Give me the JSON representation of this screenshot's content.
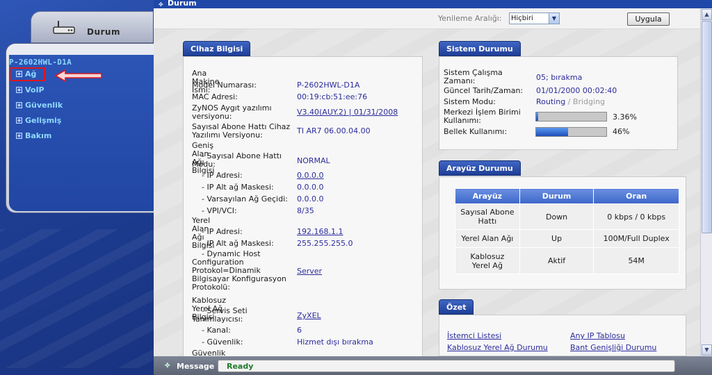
{
  "window": {
    "title": "Durum"
  },
  "sidebar": {
    "tab_label": "Durum",
    "model": "P-2602HWL-D1A",
    "items": [
      {
        "label": "Ağ"
      },
      {
        "label": "VoIP"
      },
      {
        "label": "Güvenlik"
      },
      {
        "label": "Gelişmiş"
      },
      {
        "label": "Bakım"
      }
    ]
  },
  "toolbar": {
    "refresh_label": "Yenileme Aralığı:",
    "refresh_value": "Hiçbiri",
    "apply_label": "Uygula"
  },
  "device": {
    "title": "Cihaz Bilgisi",
    "host_name_label": "Ana Makine İsmi:",
    "model_label": "Model Numarası:",
    "model_value": "P-2602HWL-D1A",
    "mac_label": "MAC Adresi:",
    "mac_value": "00:19:cb:51:ee:76",
    "zynos_label_1": "ZyNOS Aygıt yazılımı",
    "zynos_label_2": "versiyonu:",
    "zynos_value": "V3.40(AUY.2) | 01/31/2008",
    "dsl_fw_label_1": "Sayısal Abone Hattı Cihaz",
    "dsl_fw_label_2": "Yazılımı Versiyonu:",
    "dsl_fw_value": "TI AR7 06.00.04.00",
    "wan_heading": "Geniş Alan Ağı Bilgisi",
    "wan_mode_label_1": "- Sayısal Abone Hattı",
    "wan_mode_label_2": "Modu:",
    "wan_mode_value": "NORMAL",
    "wan_ip_label": "- IP Adresi:",
    "wan_ip_value": "0.0.0.0",
    "wan_mask_label": "- IP Alt ağ Maskesi:",
    "wan_mask_value": "0.0.0.0",
    "wan_gw_label": "- Varsayılan Ağ Geçidi:",
    "wan_gw_value": "0.0.0.0",
    "wan_vpi_label": "- VPI/VCI:",
    "wan_vpi_value": "8/35",
    "lan_heading": "Yerel Alan Ağı Bilgisi",
    "lan_ip_label": "- IP Adresi:",
    "lan_ip_value": "192.168.1.1",
    "lan_mask_label": "- IP Alt ağ Maskesi:",
    "lan_mask_value": "255.255.255.0",
    "dhcp_label_1": "- Dynamic Host",
    "dhcp_label_2": "Configuration",
    "dhcp_label_3": "Protokol=Dinamik",
    "dhcp_label_4": "Bilgisayar Konfigurasyon",
    "dhcp_label_5": "Protokolü:",
    "dhcp_value": "Server",
    "wlan_heading": "Kablosuz Yerel Ağ Bilgisi",
    "ssid_label_1": "- Servis Seti",
    "ssid_label_2": "Tanımlayıcısı:",
    "ssid_value": "ZyXEL",
    "channel_label": "- Kanal:",
    "channel_value": "6",
    "security_label": "- Güvenlik:",
    "security_value": "Hizmet dışı bırakma",
    "security_heading": "Güvenlik"
  },
  "system": {
    "title": "Sistem Durumu",
    "uptime_label_1": "Sistem Çalışma",
    "uptime_label_2": "Zamanı:",
    "uptime_value": "05; bırakma",
    "datetime_label": "Güncel Tarih/Zaman:",
    "datetime_value": "01/01/2000 00:02:40",
    "mode_label": "Sistem Modu:",
    "mode_routing": "Routing",
    "mode_sep": "/",
    "mode_bridging": "Bridging",
    "cpu_label_1": "Merkezi İşlem Birimi",
    "cpu_label_2": "Kullanımı:",
    "cpu_value": "3.36%",
    "cpu_fraction": 0.0336,
    "mem_label": "Bellek Kullanımı:",
    "mem_value": "46%",
    "mem_fraction": 0.46
  },
  "interfaces": {
    "title": "Arayüz Durumu",
    "headers": [
      "Arayüz",
      "Durum",
      "Oran"
    ],
    "rows": [
      {
        "name_1": "Sayısal Abone",
        "name_2": "Hattı",
        "status": "Down",
        "rate": "0 kbps / 0 kbps"
      },
      {
        "name_1": "Yerel Alan Ağı",
        "name_2": "",
        "status": "Up",
        "rate": "100M/Full Duplex"
      },
      {
        "name_1": "Kablosuz",
        "name_2": "Yerel Ağ",
        "status": "Aktif",
        "rate": "54M"
      }
    ]
  },
  "summary": {
    "title": "Özet",
    "links": [
      "İstemci Listesi",
      "Any IP Tablosu",
      "Kablosuz Yerel Ağ Durumu",
      "Bant Genişliği Durumu"
    ]
  },
  "statusbar": {
    "label": "Message",
    "text": "Ready"
  },
  "colors": {
    "nav_text": "#8fd8ff",
    "section_tab": "#2a4fae",
    "link_text": "#2c2c9c",
    "status_ok": "#1f7a2a"
  }
}
